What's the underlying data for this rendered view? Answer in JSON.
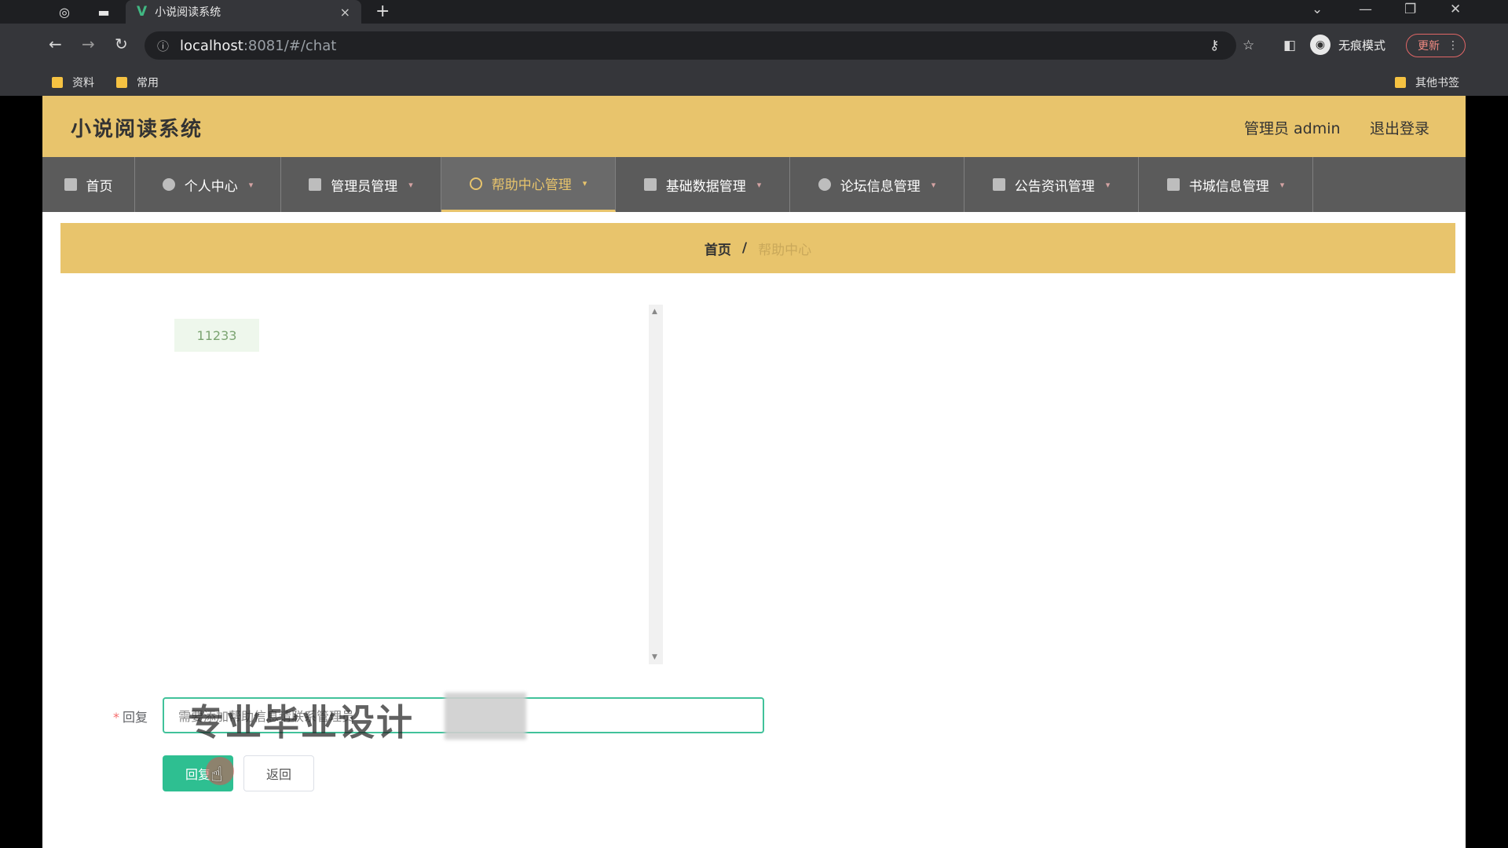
{
  "browser": {
    "tab_title": "小说阅读系统",
    "tab_close": "×",
    "new_tab": "+",
    "favicon": "V",
    "url_host": "localhost",
    "url_path": ":8081/#/chat",
    "incognito_label": "无痕模式",
    "update_label": "更新",
    "bookmarks": [
      {
        "label": "资料"
      },
      {
        "label": "常用"
      },
      {
        "label": "其他书签"
      }
    ]
  },
  "app": {
    "title": "小说阅读系统",
    "admin_label": "管理员 admin",
    "logout_label": "退出登录"
  },
  "nav": {
    "items": [
      {
        "label": "首页"
      },
      {
        "label": "个人中心"
      },
      {
        "label": "管理员管理"
      },
      {
        "label": "帮助中心管理"
      },
      {
        "label": "基础数据管理"
      },
      {
        "label": "论坛信息管理"
      },
      {
        "label": "公告资讯管理"
      },
      {
        "label": "书城信息管理"
      }
    ],
    "active_index": 3
  },
  "breadcrumb": {
    "home": "首页",
    "separator": "/",
    "current": "帮助中心"
  },
  "chat": {
    "messages": [
      {
        "text": "11233"
      }
    ]
  },
  "form": {
    "reply_label": "回复",
    "required_mark": "*",
    "reply_value": "需要添加帮助信息请联系管理员",
    "submit_label": "回复",
    "back_label": "返回"
  },
  "overlay": {
    "watermark": "专业毕业设计"
  },
  "colors": {
    "header_bg": "#e8c46c",
    "nav_bg": "#5b5b5b",
    "submit_bg": "#2ebf91",
    "input_border": "#41c29a"
  }
}
